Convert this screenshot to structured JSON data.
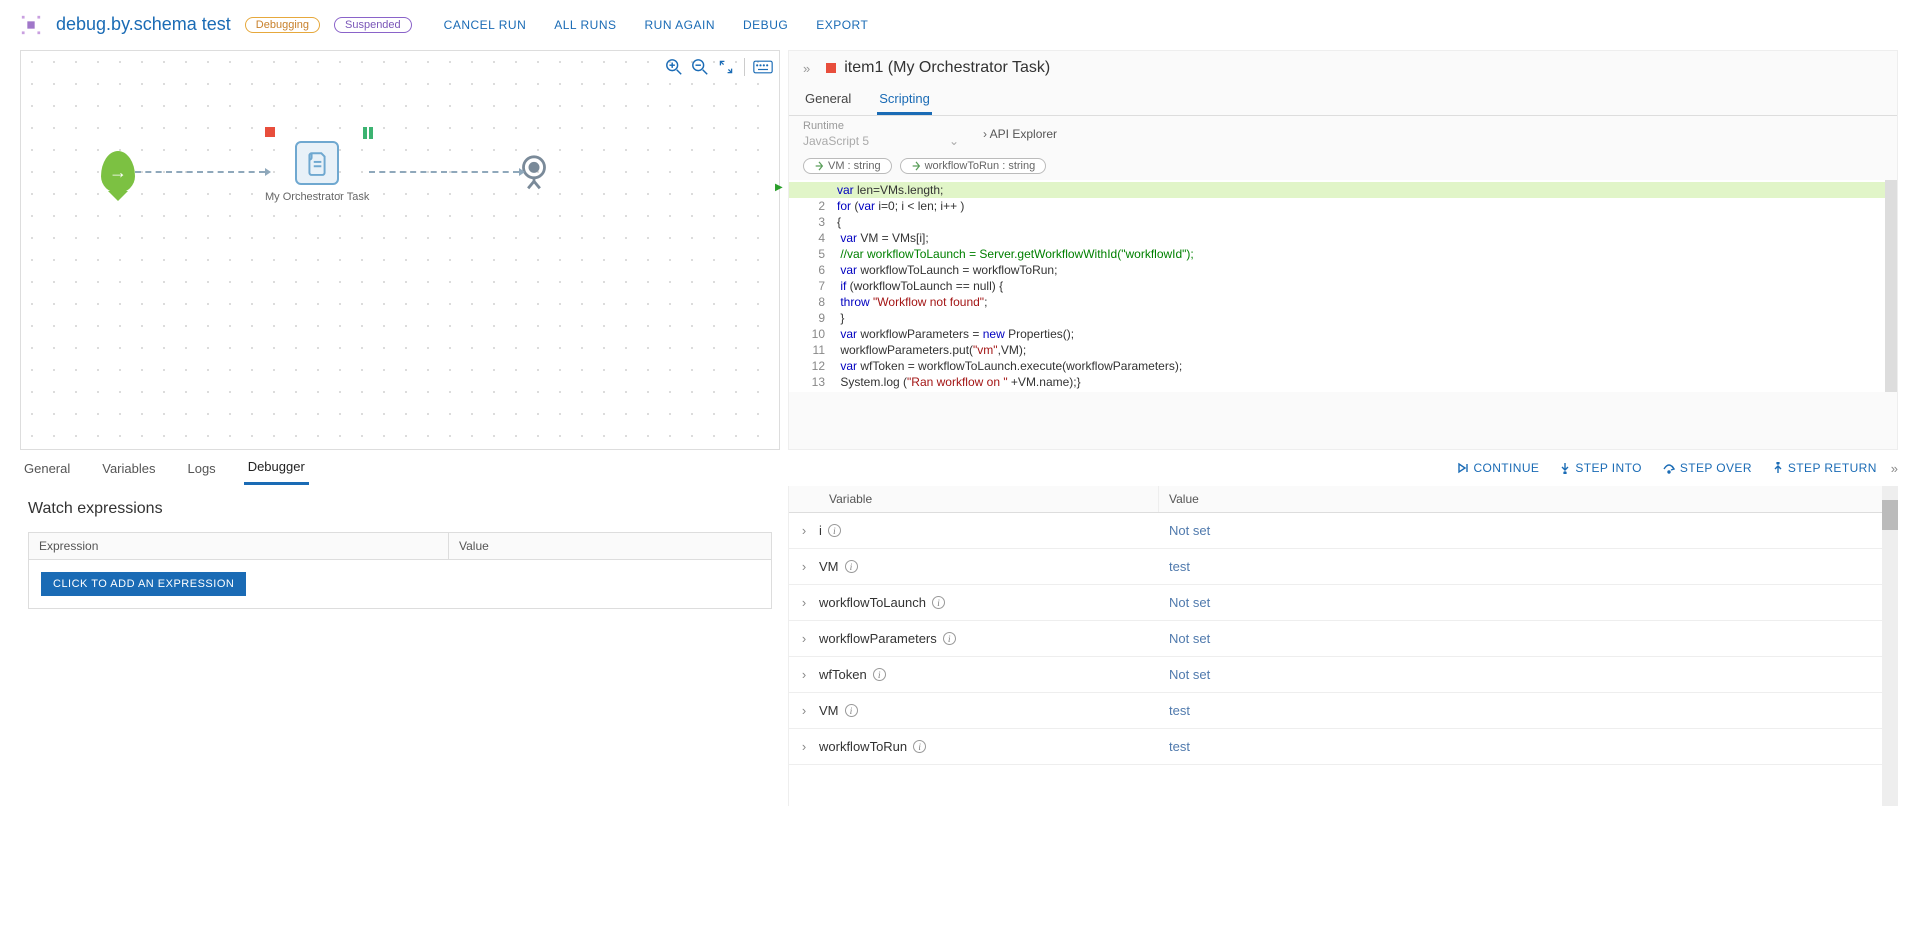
{
  "header": {
    "title": "debug.by.schema test",
    "badge_debug": "Debugging",
    "badge_suspended": "Suspended",
    "actions": {
      "cancel": "CANCEL RUN",
      "all": "ALL RUNS",
      "again": "RUN AGAIN",
      "debug": "DEBUG",
      "export": "EXPORT"
    }
  },
  "canvas": {
    "task_label": "My Orchestrator Task"
  },
  "rightPanel": {
    "title": "item1 (My Orchestrator Task)",
    "tabs": {
      "general": "General",
      "scripting": "Scripting"
    },
    "runtime_label": "Runtime",
    "runtime_value": "JavaScript 5",
    "api_link": "API Explorer",
    "params": {
      "p1": "VM : string",
      "p2": "workflowToRun : string"
    }
  },
  "code": {
    "1": "var len=VMs.length;",
    "2": "for (var i=0; i < len; i++ )",
    "3": "{",
    "4": " var VM = VMs[i];",
    "5": " //var workflowToLaunch = Server.getWorkflowWithId(\"workflowId\");",
    "6": " var workflowToLaunch = workflowToRun;",
    "7": " if (workflowToLaunch == null) {",
    "8": " throw \"Workflow not found\";",
    "9": " }",
    "10": " var workflowParameters = new Properties();",
    "11": " workflowParameters.put(\"vm\",VM);",
    "12": " var wfToken = workflowToLaunch.execute(workflowParameters);",
    "13": " System.log (\"Ran workflow on \" +VM.name);}"
  },
  "bottomTabs": {
    "general": "General",
    "variables": "Variables",
    "logs": "Logs",
    "debugger": "Debugger",
    "continue": "CONTINUE",
    "stepinto": "STEP INTO",
    "stepover": "STEP OVER",
    "stepreturn": "STEP RETURN"
  },
  "watch": {
    "title": "Watch expressions",
    "col_expr": "Expression",
    "col_val": "Value",
    "add_btn": "CLICK TO ADD AN EXPRESSION"
  },
  "varsTable": {
    "col_var": "Variable",
    "col_val": "Value",
    "rows": [
      {
        "name": "i",
        "value": "Not set"
      },
      {
        "name": "VM",
        "value": "test"
      },
      {
        "name": "workflowToLaunch",
        "value": "Not set"
      },
      {
        "name": "workflowParameters",
        "value": "Not set"
      },
      {
        "name": "wfToken",
        "value": "Not set"
      },
      {
        "name": "VM",
        "value": "test"
      },
      {
        "name": "workflowToRun",
        "value": "test"
      }
    ]
  }
}
